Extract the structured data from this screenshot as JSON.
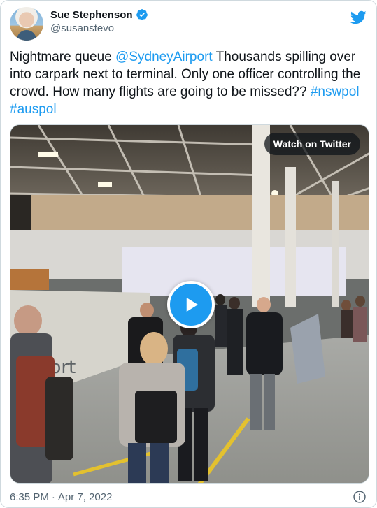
{
  "author": {
    "display_name": "Sue Stephenson",
    "handle": "@susanstevo"
  },
  "tweet": {
    "segments": [
      {
        "text": "Nightmare queue ",
        "link": false
      },
      {
        "text": "@SydneyAirport",
        "link": true
      },
      {
        "text": " Thousands spilling over into carpark next to terminal. Only one officer controlling the crowd. How many flights are going to be missed?? ",
        "link": false
      },
      {
        "text": "#nswpol",
        "link": true
      },
      {
        "text": " ",
        "link": false
      },
      {
        "text": "#auspol",
        "link": true
      }
    ]
  },
  "media": {
    "type": "video",
    "watch_label": "Watch on Twitter",
    "sign_text": "port"
  },
  "footer": {
    "time": "6:35 PM",
    "separator": "·",
    "date": "Apr 7, 2022"
  },
  "icons": {
    "twitter_logo": "twitter-bird-icon",
    "verified": "verified-badge-icon",
    "play": "play-icon",
    "info": "info-icon"
  },
  "colors": {
    "accent": "#1d9bf0",
    "text": "#0f1419",
    "muted": "#536471",
    "border": "#cfd9de"
  }
}
